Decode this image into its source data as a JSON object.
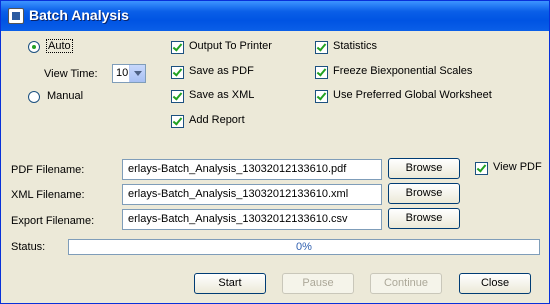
{
  "window": {
    "title": "Batch Analysis"
  },
  "mode": {
    "auto_label": "Auto",
    "view_time_label": "View Time:",
    "view_time_value": "10",
    "manual_label": "Manual",
    "selected": "Auto"
  },
  "options": {
    "output_to_printer": {
      "label": "Output To Printer",
      "checked": true
    },
    "save_as_pdf": {
      "label": "Save as PDF",
      "checked": true
    },
    "save_as_xml": {
      "label": "Save as XML",
      "checked": true
    },
    "add_report": {
      "label": "Add Report",
      "checked": true
    },
    "statistics": {
      "label": "Statistics",
      "checked": true
    },
    "freeze_biexp": {
      "label": "Freeze Biexponential Scales",
      "checked": true
    },
    "use_pref_ws": {
      "label": "Use Preferred Global Worksheet",
      "checked": true
    }
  },
  "files": {
    "pdf_label": "PDF Filename:",
    "pdf_value": "erlays-Batch_Analysis_13032012133610.pdf",
    "xml_label": "XML Filename:",
    "xml_value": "erlays-Batch_Analysis_13032012133610.xml",
    "export_label": "Export Filename:",
    "export_value": "erlays-Batch_Analysis_13032012133610.csv",
    "browse_label": "Browse",
    "view_pdf_label": "View PDF",
    "view_pdf_checked": true
  },
  "status": {
    "label": "Status:",
    "progress_text": "0%",
    "progress": 0
  },
  "buttons": {
    "start": "Start",
    "pause": "Pause",
    "continue": "Continue",
    "close": "Close"
  }
}
